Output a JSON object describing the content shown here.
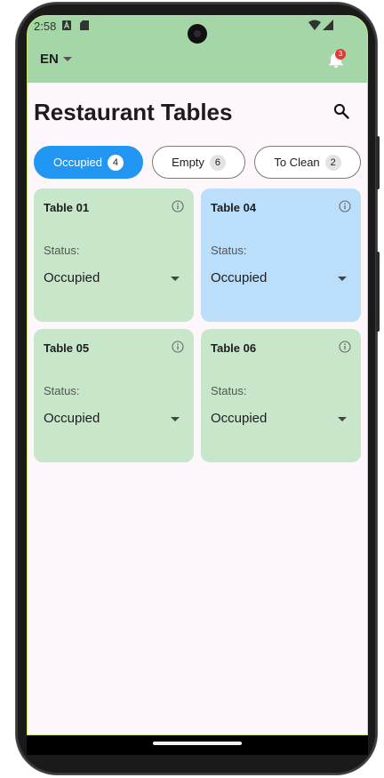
{
  "status_bar": {
    "time": "2:58"
  },
  "app_bar": {
    "language": "EN",
    "notification_count": "3"
  },
  "page": {
    "title": "Restaurant Tables"
  },
  "filters": [
    {
      "label": "Occupied",
      "count": "4",
      "active": true
    },
    {
      "label": "Empty",
      "count": "6",
      "active": false
    },
    {
      "label": "To Clean",
      "count": "2",
      "active": false
    }
  ],
  "cards": [
    {
      "name": "Table 01",
      "status_label": "Status:",
      "status_value": "Occupied",
      "color": "#c8e6c9"
    },
    {
      "name": "Table 04",
      "status_label": "Status:",
      "status_value": "Occupied",
      "color": "#bbdefb"
    },
    {
      "name": "Table 05",
      "status_label": "Status:",
      "status_value": "Occupied",
      "color": "#c8e6c9"
    },
    {
      "name": "Table 06",
      "status_label": "Status:",
      "status_value": "Occupied",
      "color": "#c8e6c9"
    }
  ],
  "colors": {
    "app_bar": "#a5d6a7",
    "active_chip": "#2196f3",
    "background": "#fdf7fc",
    "badge": "#e53935"
  },
  "icons": {
    "notification": "bell-icon",
    "search": "search-icon",
    "info": "info-icon",
    "dropdown": "caret-down-icon"
  }
}
